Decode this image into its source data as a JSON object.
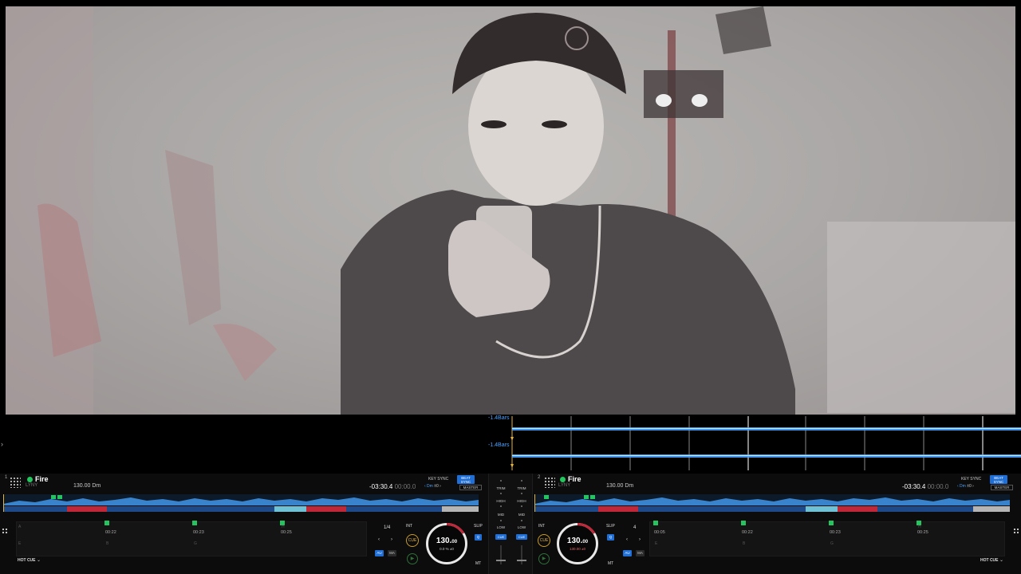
{
  "strip": {
    "arrow": "›",
    "deck1_label": "-1.4Bars",
    "deck2_label": "-1.4Bars"
  },
  "colors": {
    "accent_blue": "#1f6fd6",
    "waveform_blue": "#4aa3ff",
    "play_green": "#22c55e",
    "cue_gold": "#e3b341",
    "red_section": "#c0283a"
  },
  "deck_left": {
    "number": "1",
    "title": "Fire",
    "artist": "LYNY",
    "bpm_key": "130.00 Dm",
    "time_remaining": "-03:30.4",
    "time_elapsed": "00:00.0",
    "key_sync_label": "KEY SYNC",
    "key_value_left": "‹ Dm",
    "key_value_right": "±0 ›",
    "beat_sync_l1": "BEAT",
    "beat_sync_l2": "SYNC",
    "master_label": "MASTER",
    "cues": [
      {
        "time": "00:22",
        "letter": "B"
      },
      {
        "time": "00:23",
        "letter": "G"
      },
      {
        "time": "00:25",
        "letter": "H"
      }
    ],
    "cue_letters_left": [
      "A",
      "E"
    ],
    "hot_cue_label": "HOT CUE",
    "loop_value": "1/4",
    "int_label": "INT",
    "slip_label": "SLIP",
    "q_label": "Q",
    "au_label": "AU",
    "ma_label": "MA",
    "mt_label": "MT",
    "cue_button": "CUE",
    "prev_arrow": "‹",
    "next_arrow": "›",
    "play_icon": "▶",
    "jog_bpm_main": "130.",
    "jog_bpm_dec": "00",
    "jog_sub": "0.0 % ±0"
  },
  "deck_right": {
    "number": "2",
    "title": "Fire",
    "artist": "LYNY",
    "bpm_key": "130.00 Dm",
    "time_remaining": "-03:30.4",
    "time_elapsed": "00:00.0",
    "key_sync_label": "KEY SYNC",
    "key_value_left": "‹ Dm",
    "key_value_right": "±0 ›",
    "beat_sync_l1": "BEAT",
    "beat_sync_l2": "SYNC",
    "master_label": "MASTER",
    "cues": [
      {
        "time": "00:05",
        "letter": "A"
      },
      {
        "time": "00:22",
        "letter": "B"
      },
      {
        "time": "00:23",
        "letter": "G"
      },
      {
        "time": "00:25",
        "letter": "H"
      }
    ],
    "cue_letter_left": "E",
    "hot_cue_label": "HOT CUE",
    "loop_value": "4",
    "int_label": "INT",
    "slip_label": "SLIP",
    "q_label": "Q",
    "au_label": "AU",
    "ma_label": "MA",
    "mt_label": "MT",
    "cue_button": "CUE",
    "prev_arrow": "‹",
    "next_arrow": "›",
    "play_icon": "▶",
    "jog_bpm_main": "130.",
    "jog_bpm_dec": "00",
    "jog_sub": "130.00 ±0"
  },
  "mixer": {
    "trim": "TRIM",
    "high": "HIGH",
    "mid": "MID",
    "low": "LOW",
    "cue": "CUE"
  }
}
